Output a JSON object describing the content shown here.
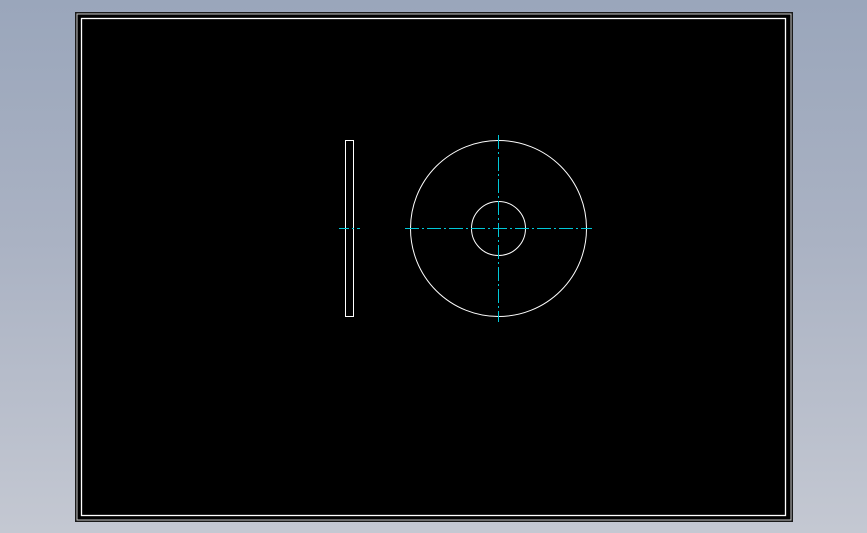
{
  "viewport": {
    "background": "gradient-grey-blue",
    "sheet_color": "#000000",
    "sheet_frame_color": "#ffffff",
    "geometry_color": "#ffffff",
    "centerline_color": "#00c8d8",
    "centerline_style": "dash-dot"
  },
  "drawing": {
    "views": [
      {
        "id": "side-view",
        "shape": "thin-rectangle"
      },
      {
        "id": "front-view",
        "shape": "washer",
        "features": [
          "outer-circle",
          "inner-hole",
          "horizontal-centerline",
          "vertical-centerline"
        ]
      }
    ]
  }
}
